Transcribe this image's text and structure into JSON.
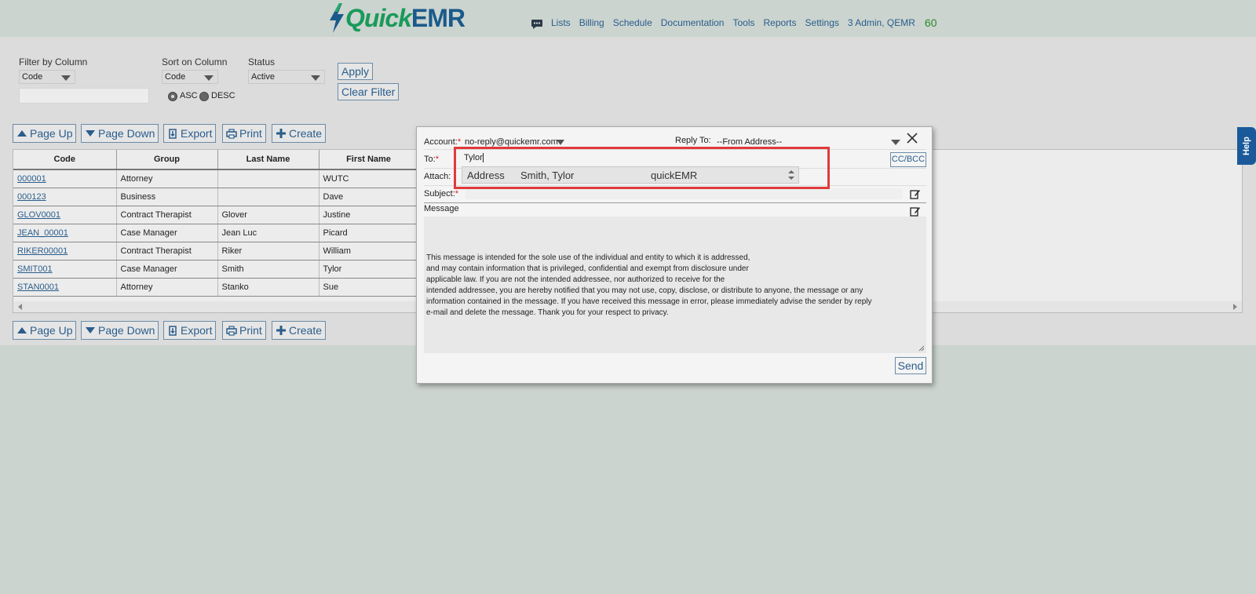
{
  "brand": {
    "quick": "Quick",
    "emr": "EMR"
  },
  "nav": {
    "items": [
      "Lists",
      "Billing",
      "Schedule",
      "Documentation",
      "Tools",
      "Reports",
      "Settings",
      "3 Admin, QEMR"
    ],
    "count": "60"
  },
  "filters": {
    "filter_by_label": "Filter by Column",
    "filter_by_value": "Code",
    "sort_label": "Sort on Column",
    "sort_value": "Code",
    "status_label": "Status",
    "status_value": "Active",
    "asc": "ASC",
    "desc": "DESC",
    "apply": "Apply",
    "clear": "Clear Filter"
  },
  "toolbar": {
    "page_up": "Page Up",
    "page_down": "Page Down",
    "export": "Export",
    "print": "Print",
    "create": "Create"
  },
  "table": {
    "headers": [
      "Code",
      "Group",
      "Last Name",
      "First Name"
    ],
    "rows": [
      [
        "000001",
        "Attorney",
        "",
        "WUTC"
      ],
      [
        "000123",
        "Business",
        "",
        "Dave"
      ],
      [
        "GLOV0001",
        "Contract Therapist",
        "Glover",
        "Justine"
      ],
      [
        "JEAN_00001",
        "Case Manager",
        "Jean Luc",
        "Picard"
      ],
      [
        "RIKER00001",
        "Contract Therapist",
        "Riker",
        "William"
      ],
      [
        "SMIT001",
        "Case Manager",
        "Smith",
        "Tylor"
      ],
      [
        "STAN0001",
        "Attorney",
        "Stanko",
        "Sue"
      ]
    ]
  },
  "help": "Help",
  "email": {
    "account_label": "Account:",
    "account_value": "no-reply@quickemr.com",
    "reply_to_label": "Reply To:",
    "reply_to_value": "--From Address--",
    "to_label": "To:",
    "to_value": "Tylor",
    "cc_bcc": "CC/BCC",
    "attach_label": "Attach:",
    "subject_label": "Subject:",
    "message_label": "Message",
    "message_body": "This message is intended for the sole use of the individual and entity to which it is addressed,\nand may contain information that is privileged, confidential and exempt from disclosure under\napplicable law. If you are not the intended addressee, nor authorized to receive for the\nintended addressee, you are hereby notified that you may not use, copy, disclose, or distribute to anyone, the message or any\ninformation contained in the message. If you have received this message in error, please immediately advise the sender by reply\ne-mail and delete the message. Thank you for your respect to privacy.",
    "send": "Send",
    "autocomplete": {
      "type": "Address",
      "name": "Smith, Tylor",
      "source": "quickEMR"
    }
  }
}
